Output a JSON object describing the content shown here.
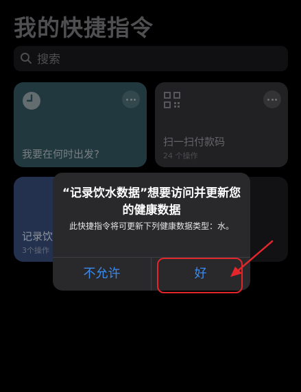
{
  "header": {
    "title": "我的快捷指令"
  },
  "search": {
    "placeholder": "搜索"
  },
  "cards": [
    {
      "title": "我要在何时出发?",
      "icon": "clock-icon",
      "color": "#2e4f57"
    },
    {
      "title": "扫一扫付款码",
      "subtitle": "24 个操作",
      "icon": "qr-code-icon",
      "color": "#2e2e31"
    },
    {
      "title": "记录饮",
      "subtitle": "3个操作",
      "color": "#32456c"
    }
  ],
  "alert": {
    "title": "“记录饮水数据”想要访问并更新您的健康数据",
    "message": "此快捷指令将可更新下列健康数据类型：水。",
    "deny_label": "不允许",
    "allow_label": "好"
  },
  "annotation": {
    "color": "#e2262b"
  }
}
